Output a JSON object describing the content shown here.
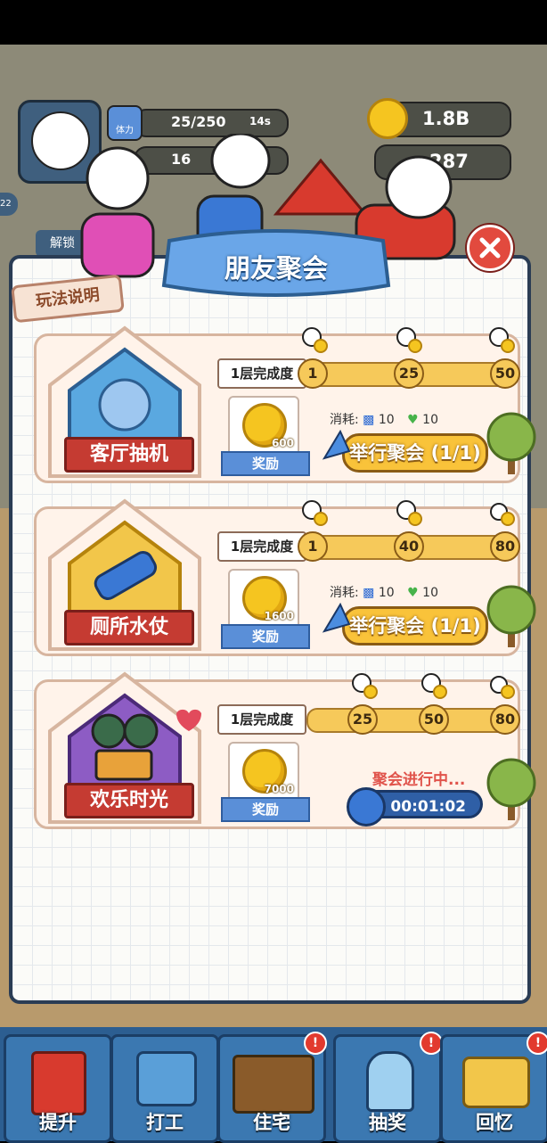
{
  "hud": {
    "stamina_label": "体力",
    "stamina_value": "25/250",
    "stamina_timer": "14s",
    "second_value": "16",
    "coins": "1.8B",
    "gems": "287",
    "side_badge": "22",
    "unlock_label": "解锁"
  },
  "modal": {
    "title": "朋友聚会",
    "rules_button": "玩法说明",
    "close_icon": "close-x-icon"
  },
  "parties": [
    {
      "name": "客厅抽机",
      "layer_label": "1层完成度",
      "milestones": [
        "1",
        "25",
        "50"
      ],
      "reward_value": "600",
      "reward_label": "奖励",
      "cost_label": "消耗:",
      "cost_stamina": "10",
      "cost_heart": "10",
      "action_label": "举行聚会 (1/1)"
    },
    {
      "name": "厕所水仗",
      "layer_label": "1层完成度",
      "milestones": [
        "1",
        "40",
        "80"
      ],
      "reward_value": "1600",
      "reward_label": "奖励",
      "cost_label": "消耗:",
      "cost_stamina": "10",
      "cost_heart": "10",
      "action_label": "举行聚会 (1/1)"
    },
    {
      "name": "欢乐时光",
      "layer_label": "1层完成度",
      "milestones": [
        "25",
        "50",
        "80"
      ],
      "reward_value": "7000",
      "reward_label": "奖励",
      "status": "聚会进行中...",
      "timer": "00:01:02"
    }
  ],
  "bottom_tabs": [
    {
      "label": "提升",
      "alert": false
    },
    {
      "label": "打工",
      "alert": false
    },
    {
      "label": "住宅",
      "alert": true
    },
    {
      "label": "抽奖",
      "alert": true
    },
    {
      "label": "回忆",
      "alert": true
    }
  ],
  "alert_mark": "!",
  "colors": {
    "accent_red": "#c53b32",
    "button_yellow": "#f9c33a",
    "title_blue": "#5a8fd8"
  }
}
